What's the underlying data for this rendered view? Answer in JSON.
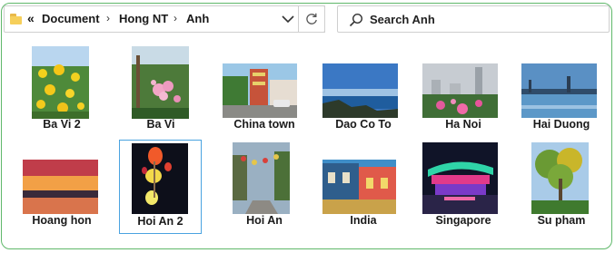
{
  "address_bar": {
    "overflow_label": "«",
    "crumbs": [
      "Document",
      "Hong NT",
      "Anh"
    ],
    "separator": "›"
  },
  "search": {
    "placeholder": "Search Anh"
  },
  "files": [
    {
      "name": "Ba Vi 2"
    },
    {
      "name": "Ba Vi"
    },
    {
      "name": "China town"
    },
    {
      "name": "Dao Co To"
    },
    {
      "name": "Ha Noi"
    },
    {
      "name": "Hai Duong"
    },
    {
      "name": "Hoang hon"
    },
    {
      "name": "Hoi An 2",
      "selected": true
    },
    {
      "name": "Hoi An"
    },
    {
      "name": "India"
    },
    {
      "name": "Singapore"
    },
    {
      "name": "Su pham"
    }
  ],
  "colors": {
    "frame_border": "#5fb86a",
    "selection": "#4aa3e0"
  }
}
